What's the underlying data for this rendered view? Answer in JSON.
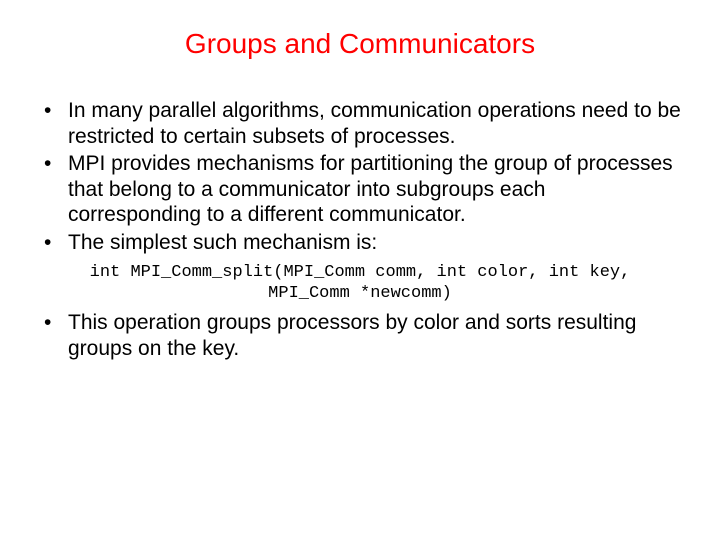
{
  "title": "Groups and Communicators",
  "bullets": {
    "b1": "In many parallel algorithms, communication operations need to be restricted to certain subsets of processes.",
    "b2": "MPI provides mechanisms for partitioning the group of processes that belong to a communicator into subgroups each corresponding to a different communicator.",
    "b3": "The simplest such mechanism is:",
    "b4": "This operation groups processors by color and sorts resulting groups on the key."
  },
  "code": {
    "line1": "int MPI_Comm_split(MPI_Comm comm, int color, int key,",
    "line2": "MPI_Comm *newcomm)"
  }
}
